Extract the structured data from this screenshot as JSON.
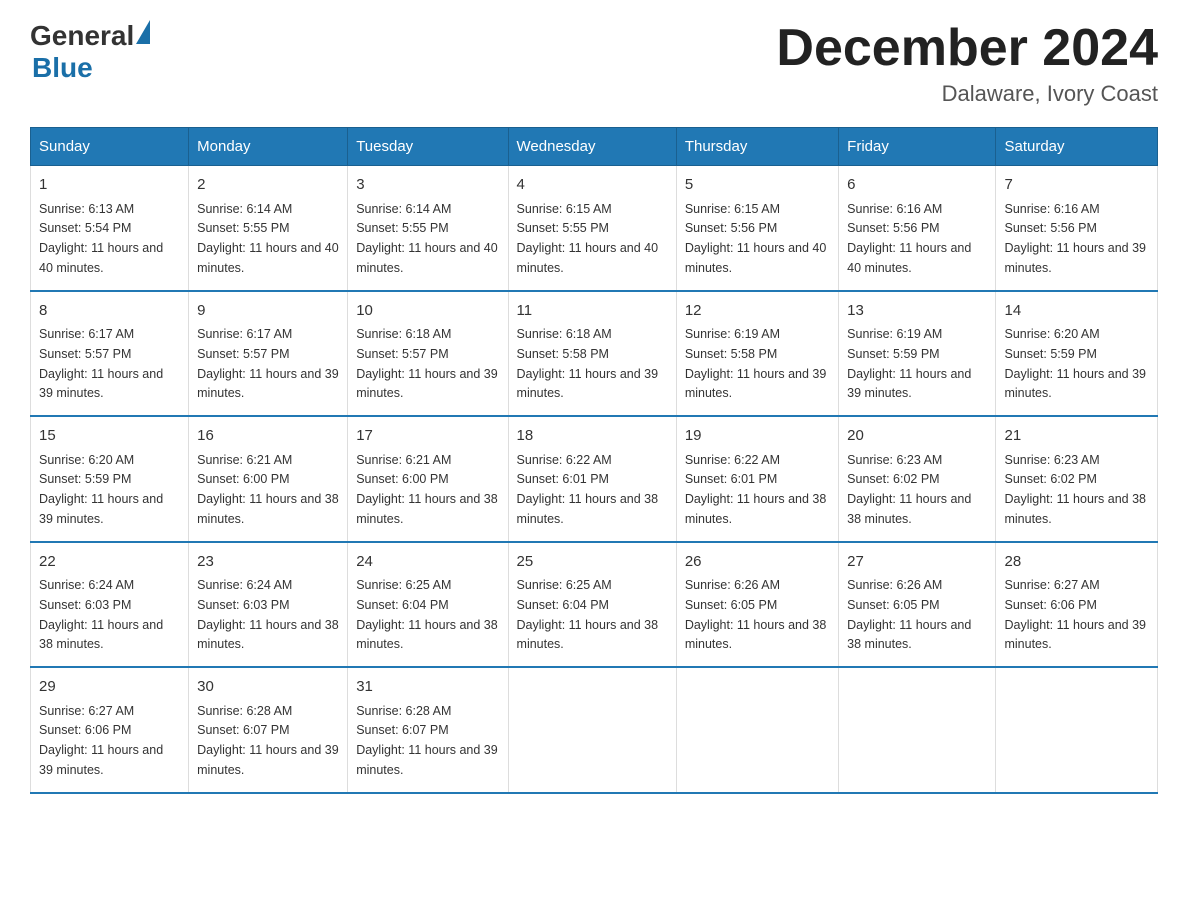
{
  "logo": {
    "general": "General",
    "blue": "Blue"
  },
  "title": "December 2024",
  "subtitle": "Dalaware, Ivory Coast",
  "days_of_week": [
    "Sunday",
    "Monday",
    "Tuesday",
    "Wednesday",
    "Thursday",
    "Friday",
    "Saturday"
  ],
  "weeks": [
    [
      {
        "day": "1",
        "sunrise": "6:13 AM",
        "sunset": "5:54 PM",
        "daylight": "11 hours and 40 minutes."
      },
      {
        "day": "2",
        "sunrise": "6:14 AM",
        "sunset": "5:55 PM",
        "daylight": "11 hours and 40 minutes."
      },
      {
        "day": "3",
        "sunrise": "6:14 AM",
        "sunset": "5:55 PM",
        "daylight": "11 hours and 40 minutes."
      },
      {
        "day": "4",
        "sunrise": "6:15 AM",
        "sunset": "5:55 PM",
        "daylight": "11 hours and 40 minutes."
      },
      {
        "day": "5",
        "sunrise": "6:15 AM",
        "sunset": "5:56 PM",
        "daylight": "11 hours and 40 minutes."
      },
      {
        "day": "6",
        "sunrise": "6:16 AM",
        "sunset": "5:56 PM",
        "daylight": "11 hours and 40 minutes."
      },
      {
        "day": "7",
        "sunrise": "6:16 AM",
        "sunset": "5:56 PM",
        "daylight": "11 hours and 39 minutes."
      }
    ],
    [
      {
        "day": "8",
        "sunrise": "6:17 AM",
        "sunset": "5:57 PM",
        "daylight": "11 hours and 39 minutes."
      },
      {
        "day": "9",
        "sunrise": "6:17 AM",
        "sunset": "5:57 PM",
        "daylight": "11 hours and 39 minutes."
      },
      {
        "day": "10",
        "sunrise": "6:18 AM",
        "sunset": "5:57 PM",
        "daylight": "11 hours and 39 minutes."
      },
      {
        "day": "11",
        "sunrise": "6:18 AM",
        "sunset": "5:58 PM",
        "daylight": "11 hours and 39 minutes."
      },
      {
        "day": "12",
        "sunrise": "6:19 AM",
        "sunset": "5:58 PM",
        "daylight": "11 hours and 39 minutes."
      },
      {
        "day": "13",
        "sunrise": "6:19 AM",
        "sunset": "5:59 PM",
        "daylight": "11 hours and 39 minutes."
      },
      {
        "day": "14",
        "sunrise": "6:20 AM",
        "sunset": "5:59 PM",
        "daylight": "11 hours and 39 minutes."
      }
    ],
    [
      {
        "day": "15",
        "sunrise": "6:20 AM",
        "sunset": "5:59 PM",
        "daylight": "11 hours and 39 minutes."
      },
      {
        "day": "16",
        "sunrise": "6:21 AM",
        "sunset": "6:00 PM",
        "daylight": "11 hours and 38 minutes."
      },
      {
        "day": "17",
        "sunrise": "6:21 AM",
        "sunset": "6:00 PM",
        "daylight": "11 hours and 38 minutes."
      },
      {
        "day": "18",
        "sunrise": "6:22 AM",
        "sunset": "6:01 PM",
        "daylight": "11 hours and 38 minutes."
      },
      {
        "day": "19",
        "sunrise": "6:22 AM",
        "sunset": "6:01 PM",
        "daylight": "11 hours and 38 minutes."
      },
      {
        "day": "20",
        "sunrise": "6:23 AM",
        "sunset": "6:02 PM",
        "daylight": "11 hours and 38 minutes."
      },
      {
        "day": "21",
        "sunrise": "6:23 AM",
        "sunset": "6:02 PM",
        "daylight": "11 hours and 38 minutes."
      }
    ],
    [
      {
        "day": "22",
        "sunrise": "6:24 AM",
        "sunset": "6:03 PM",
        "daylight": "11 hours and 38 minutes."
      },
      {
        "day": "23",
        "sunrise": "6:24 AM",
        "sunset": "6:03 PM",
        "daylight": "11 hours and 38 minutes."
      },
      {
        "day": "24",
        "sunrise": "6:25 AM",
        "sunset": "6:04 PM",
        "daylight": "11 hours and 38 minutes."
      },
      {
        "day": "25",
        "sunrise": "6:25 AM",
        "sunset": "6:04 PM",
        "daylight": "11 hours and 38 minutes."
      },
      {
        "day": "26",
        "sunrise": "6:26 AM",
        "sunset": "6:05 PM",
        "daylight": "11 hours and 38 minutes."
      },
      {
        "day": "27",
        "sunrise": "6:26 AM",
        "sunset": "6:05 PM",
        "daylight": "11 hours and 38 minutes."
      },
      {
        "day": "28",
        "sunrise": "6:27 AM",
        "sunset": "6:06 PM",
        "daylight": "11 hours and 39 minutes."
      }
    ],
    [
      {
        "day": "29",
        "sunrise": "6:27 AM",
        "sunset": "6:06 PM",
        "daylight": "11 hours and 39 minutes."
      },
      {
        "day": "30",
        "sunrise": "6:28 AM",
        "sunset": "6:07 PM",
        "daylight": "11 hours and 39 minutes."
      },
      {
        "day": "31",
        "sunrise": "6:28 AM",
        "sunset": "6:07 PM",
        "daylight": "11 hours and 39 minutes."
      },
      null,
      null,
      null,
      null
    ]
  ]
}
